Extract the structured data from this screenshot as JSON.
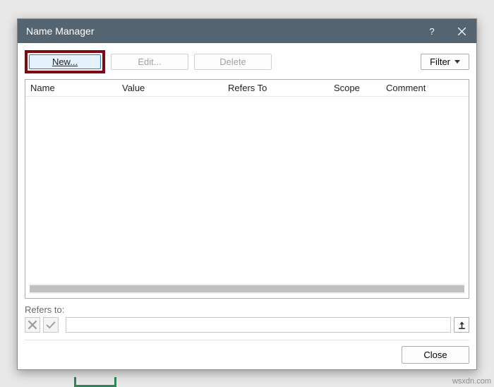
{
  "dialog": {
    "title": "Name Manager",
    "toolbar": {
      "new_label": "New...",
      "new_hotkey": "N",
      "edit_label": "Edit...",
      "delete_label": "Delete",
      "filter_label": "Filter"
    },
    "columns": {
      "name": "Name",
      "value": "Value",
      "refers_to": "Refers To",
      "scope": "Scope",
      "comment": "Comment"
    },
    "refers": {
      "label": "Refers to:",
      "value": ""
    },
    "footer": {
      "close_label": "Close"
    }
  },
  "watermark": "wsxdn.com"
}
